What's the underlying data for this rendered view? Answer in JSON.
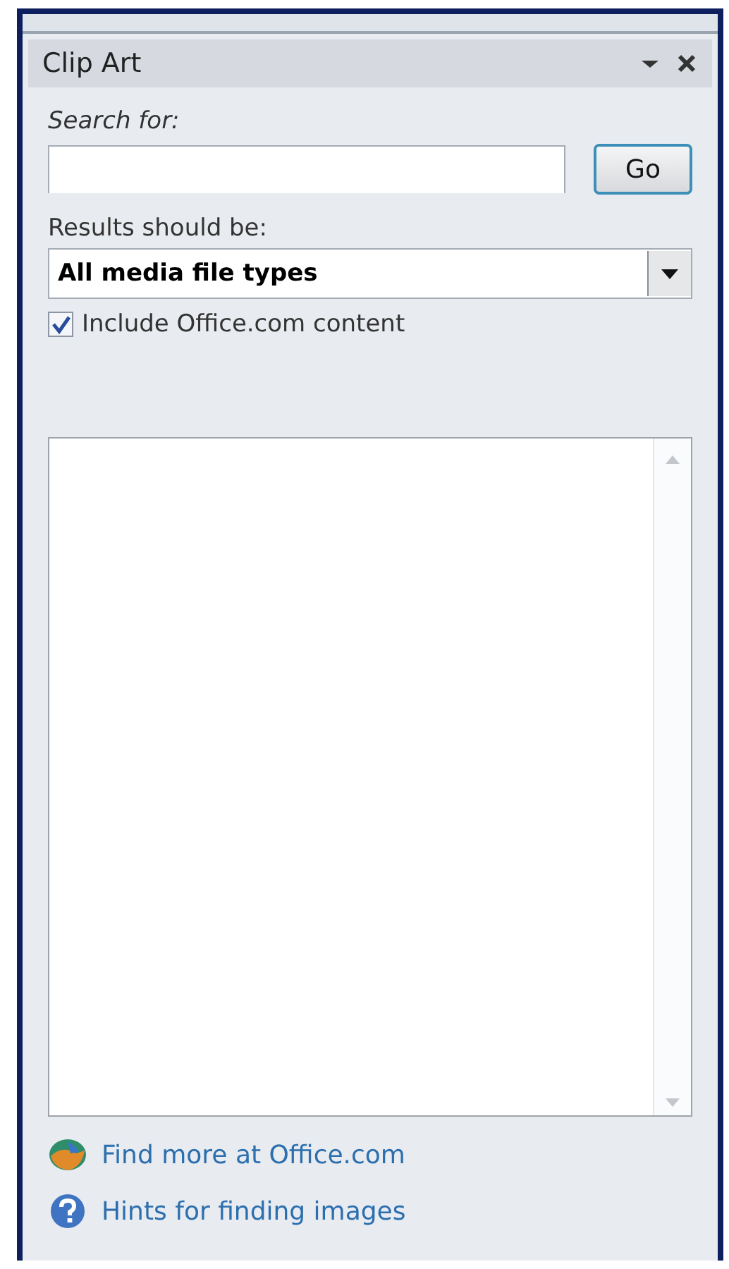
{
  "pane": {
    "title": "Clip Art"
  },
  "search": {
    "label": "Search for:",
    "button": "Go"
  },
  "results_type": {
    "label": "Results should be:",
    "value": "All media file types"
  },
  "include_online": {
    "label": "Include Office.com content",
    "checked": true
  },
  "links": [
    {
      "kind": "globe",
      "text": "Find more at Office.com"
    },
    {
      "kind": "help",
      "text": "Hints for finding images"
    }
  ]
}
